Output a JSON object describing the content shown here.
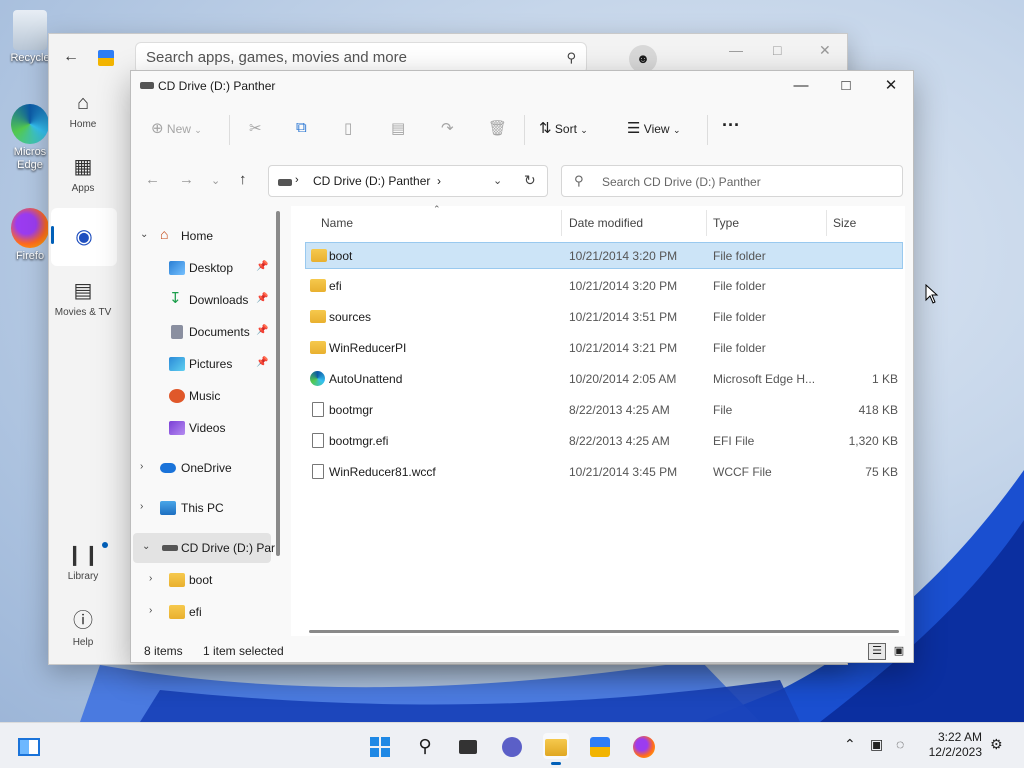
{
  "desktop": {
    "icons": [
      {
        "label": "Recycle",
        "icon": "recycle-bin-icon"
      },
      {
        "label": "Micros Edge",
        "icon": "edge-icon"
      },
      {
        "label": "Firefo",
        "icon": "firefox-icon"
      }
    ]
  },
  "store": {
    "search_placeholder": "Search apps, games, movies and more",
    "rail": [
      {
        "label": "Home",
        "icon": "home-icon"
      },
      {
        "label": "Apps",
        "icon": "apps-icon"
      },
      {
        "label": "",
        "icon": "gamepad-icon"
      },
      {
        "label": "Movies & TV",
        "icon": "clapper-icon"
      },
      {
        "label": "Library",
        "icon": "library-icon"
      },
      {
        "label": "Help",
        "icon": "help-icon"
      }
    ]
  },
  "explorer": {
    "title": "CD Drive (D:) Panther",
    "commands": {
      "new": "New",
      "sort": "Sort",
      "view": "View",
      "more": "···"
    },
    "address": {
      "path": "CD Drive (D:) Panther",
      "search_placeholder": "Search CD Drive (D:) Panther"
    },
    "nav": [
      {
        "label": "Home",
        "icon": "home-icon",
        "pinned": false
      },
      {
        "label": "Desktop",
        "icon": "desktop-icon",
        "pinned": true
      },
      {
        "label": "Downloads",
        "icon": "download-icon",
        "pinned": true
      },
      {
        "label": "Documents",
        "icon": "documents-icon",
        "pinned": true
      },
      {
        "label": "Pictures",
        "icon": "pictures-icon",
        "pinned": true
      },
      {
        "label": "Music",
        "icon": "music-icon",
        "pinned": false
      },
      {
        "label": "Videos",
        "icon": "videos-icon",
        "pinned": false
      },
      {
        "label": "OneDrive",
        "icon": "cloud-icon",
        "pinned": false
      },
      {
        "label": "This PC",
        "icon": "pc-icon",
        "pinned": false
      },
      {
        "label": "CD Drive (D:) Par",
        "icon": "drive-icon",
        "pinned": false
      },
      {
        "label": "boot",
        "icon": "folder-icon",
        "pinned": false
      },
      {
        "label": "efi",
        "icon": "folder-icon",
        "pinned": false
      }
    ],
    "columns": {
      "name": "Name",
      "date": "Date modified",
      "type": "Type",
      "size": "Size"
    },
    "files": [
      {
        "name": "boot",
        "date": "10/21/2014 3:20 PM",
        "type": "File folder",
        "size": "",
        "kind": "folder"
      },
      {
        "name": "efi",
        "date": "10/21/2014 3:20 PM",
        "type": "File folder",
        "size": "",
        "kind": "folder"
      },
      {
        "name": "sources",
        "date": "10/21/2014 3:51 PM",
        "type": "File folder",
        "size": "",
        "kind": "folder"
      },
      {
        "name": "WinReducerPI",
        "date": "10/21/2014 3:21 PM",
        "type": "File folder",
        "size": "",
        "kind": "folder"
      },
      {
        "name": "AutoUnattend",
        "date": "10/20/2014 2:05 AM",
        "type": "Microsoft Edge H...",
        "size": "1 KB",
        "kind": "edge"
      },
      {
        "name": "bootmgr",
        "date": "8/22/2013 4:25 AM",
        "type": "File",
        "size": "418 KB",
        "kind": "file"
      },
      {
        "name": "bootmgr.efi",
        "date": "8/22/2013 4:25 AM",
        "type": "EFI File",
        "size": "1,320 KB",
        "kind": "file"
      },
      {
        "name": "WinReducer81.wccf",
        "date": "10/21/2014 3:45 PM",
        "type": "WCCF File",
        "size": "75 KB",
        "kind": "file"
      }
    ],
    "status": {
      "count": "8 items",
      "selection": "1 item selected"
    }
  },
  "taskbar": {
    "time": "3:22 AM",
    "date": "12/2/2023"
  },
  "colors": {
    "accent": "#005fb8",
    "selection": "#cce4f7",
    "folder": "#f0be3c"
  }
}
